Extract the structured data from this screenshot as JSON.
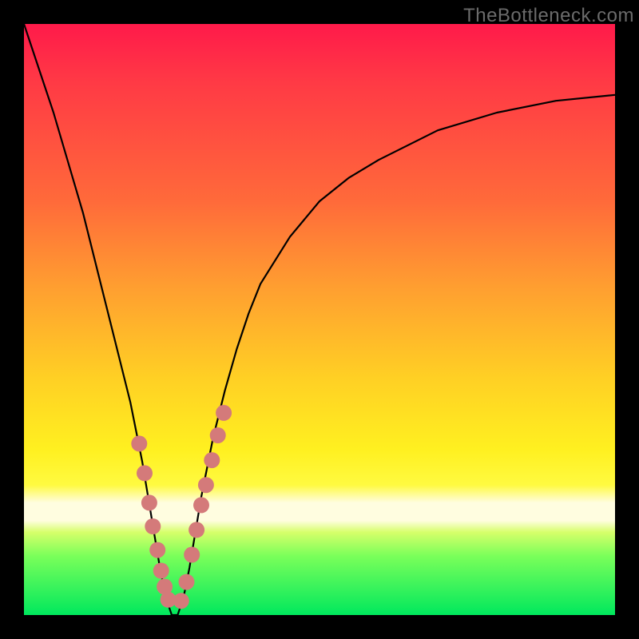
{
  "watermark": "TheBottleneck.com",
  "chart_data": {
    "type": "line",
    "title": "",
    "xlabel": "",
    "ylabel": "",
    "xlim": [
      0,
      100
    ],
    "ylim": [
      0,
      100
    ],
    "grid": false,
    "legend": false,
    "x": [
      0,
      5,
      10,
      14,
      16,
      18,
      20,
      21,
      22,
      23,
      24,
      25,
      26,
      27,
      28,
      29,
      30,
      32,
      34,
      36,
      38,
      40,
      45,
      50,
      55,
      60,
      70,
      80,
      90,
      100
    ],
    "y": [
      100,
      85,
      68,
      52,
      44,
      36,
      26,
      20,
      14,
      8,
      3,
      0,
      0,
      3,
      8,
      14,
      20,
      30,
      38,
      45,
      51,
      56,
      64,
      70,
      74,
      77,
      82,
      85,
      87,
      88
    ],
    "series": [
      {
        "name": "curve",
        "x": [
          0,
          5,
          10,
          14,
          16,
          18,
          20,
          21,
          22,
          23,
          24,
          25,
          26,
          27,
          28,
          29,
          30,
          32,
          34,
          36,
          38,
          40,
          45,
          50,
          55,
          60,
          70,
          80,
          90,
          100
        ],
        "y": [
          100,
          85,
          68,
          52,
          44,
          36,
          26,
          20,
          14,
          8,
          3,
          0,
          0,
          3,
          8,
          14,
          20,
          30,
          38,
          45,
          51,
          56,
          64,
          70,
          74,
          77,
          82,
          85,
          87,
          88
        ]
      }
    ],
    "markers": {
      "name": "beads",
      "x": [
        19.5,
        20.4,
        21.2,
        21.8,
        22.6,
        23.2,
        23.8,
        24.4,
        26.6,
        27.5,
        28.4,
        29.2,
        30.0,
        30.8,
        31.8,
        32.8,
        33.8
      ],
      "y": [
        29,
        24,
        19,
        15,
        11,
        7.5,
        4.8,
        2.6,
        2.4,
        5.6,
        10.2,
        14.4,
        18.6,
        22.0,
        26.2,
        30.4,
        34.2
      ]
    },
    "gradient_stops": [
      {
        "pos": 0,
        "color": "#ff1a4a"
      },
      {
        "pos": 0.3,
        "color": "#ff6a3a"
      },
      {
        "pos": 0.6,
        "color": "#ffd024"
      },
      {
        "pos": 0.82,
        "color": "#fffde0"
      },
      {
        "pos": 1.0,
        "color": "#00e85d"
      }
    ]
  }
}
